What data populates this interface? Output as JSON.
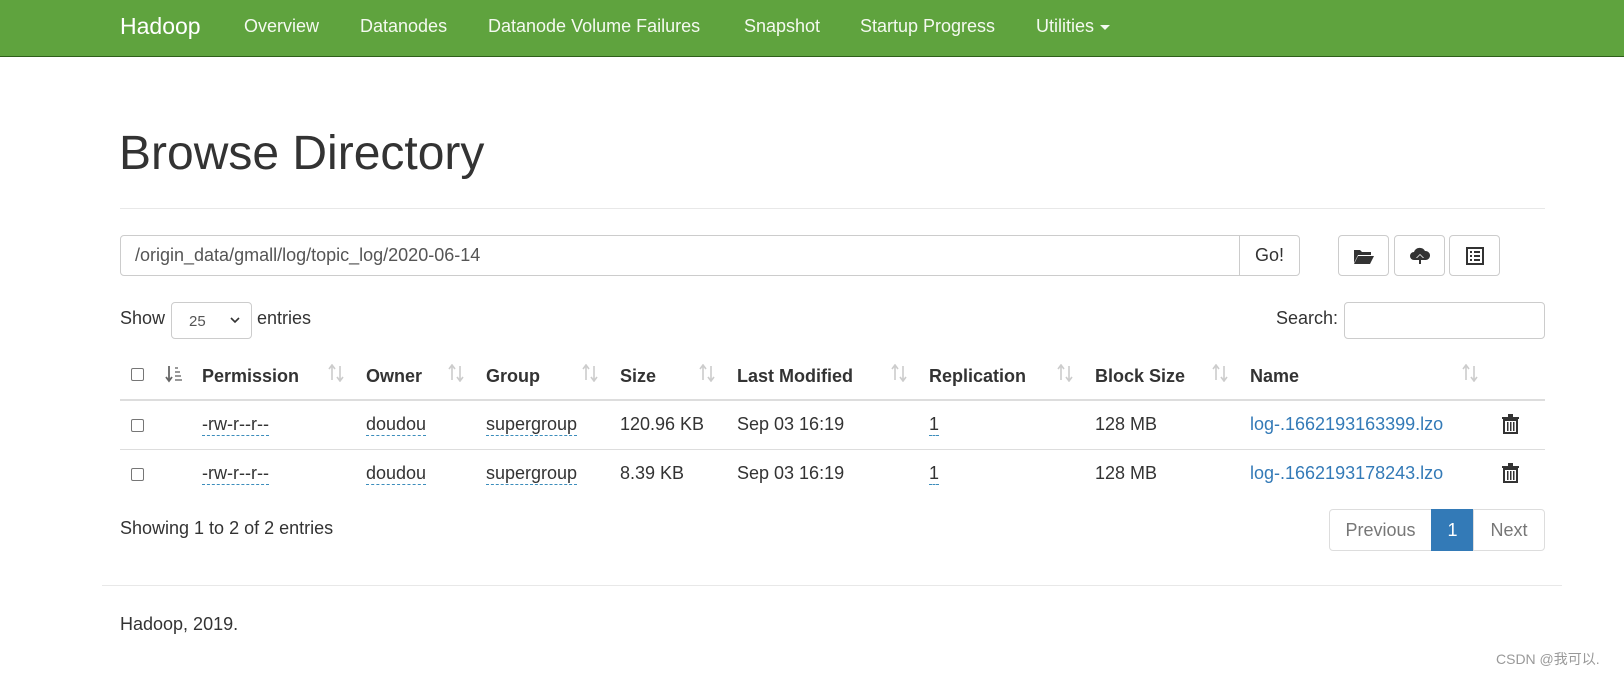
{
  "navbar": {
    "brand": "Hadoop",
    "items": [
      {
        "label": "Overview"
      },
      {
        "label": "Datanodes"
      },
      {
        "label": "Datanode Volume Failures"
      },
      {
        "label": "Snapshot"
      },
      {
        "label": "Startup Progress"
      },
      {
        "label": "Utilities"
      }
    ],
    "color": "#5fa33e"
  },
  "page_title": "Browse Directory",
  "path_bar": {
    "path": "/origin_data/gmall/log/topic_log/2020-06-14",
    "go_label": "Go!",
    "tools": [
      {
        "icon": "folder-open-icon"
      },
      {
        "icon": "cloud-upload-icon"
      },
      {
        "icon": "list-alt-icon"
      }
    ]
  },
  "entries": {
    "show_label": "Show",
    "selected": "25",
    "entries_label": "entries",
    "search_label": "Search:"
  },
  "table": {
    "columns": [
      "Permission",
      "Owner",
      "Group",
      "Size",
      "Last Modified",
      "Replication",
      "Block Size",
      "Name"
    ],
    "rows": [
      {
        "permission": "-rw-r--r--",
        "owner": "doudou",
        "group": "supergroup",
        "size": "120.96 KB",
        "modified": "Sep 03 16:19",
        "replication": "1",
        "block_size": "128 MB",
        "name": "log-.1662193163399.lzo"
      },
      {
        "permission": "-rw-r--r--",
        "owner": "doudou",
        "group": "supergroup",
        "size": "8.39 KB",
        "modified": "Sep 03 16:19",
        "replication": "1",
        "block_size": "128 MB",
        "name": "log-.1662193178243.lzo"
      }
    ]
  },
  "pagination": {
    "summary": "Showing 1 to 2 of 2 entries",
    "previous": "Previous",
    "current": "1",
    "next": "Next"
  },
  "footer": "Hadoop, 2019.",
  "watermark": "CSDN @我可以."
}
